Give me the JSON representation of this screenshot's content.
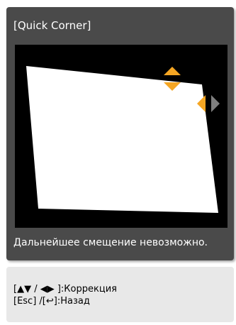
{
  "dialog": {
    "title": "[Quick Corner]",
    "status_message": "Дальнейшее смещение невозможно."
  },
  "help": {
    "line1_keys": "[▲▼ / ◀▶ ]",
    "line1_action": ":Коррекция",
    "line2_keys": "[Esc] /[↩]",
    "line2_action": ":Назад"
  },
  "colors": {
    "dialog_bg": "#4a4a4a",
    "preview_bg": "#000000",
    "image_fill": "#ffffff",
    "active_arrow": "#f5a623",
    "inactive_arrow": "#7f7f7f",
    "help_bg": "#e8e8e8"
  },
  "icons": {
    "up_arrow": "up-arrow-icon",
    "down_arrow": "down-arrow-icon",
    "left_arrow": "left-arrow-icon",
    "right_arrow": "right-arrow-icon"
  }
}
